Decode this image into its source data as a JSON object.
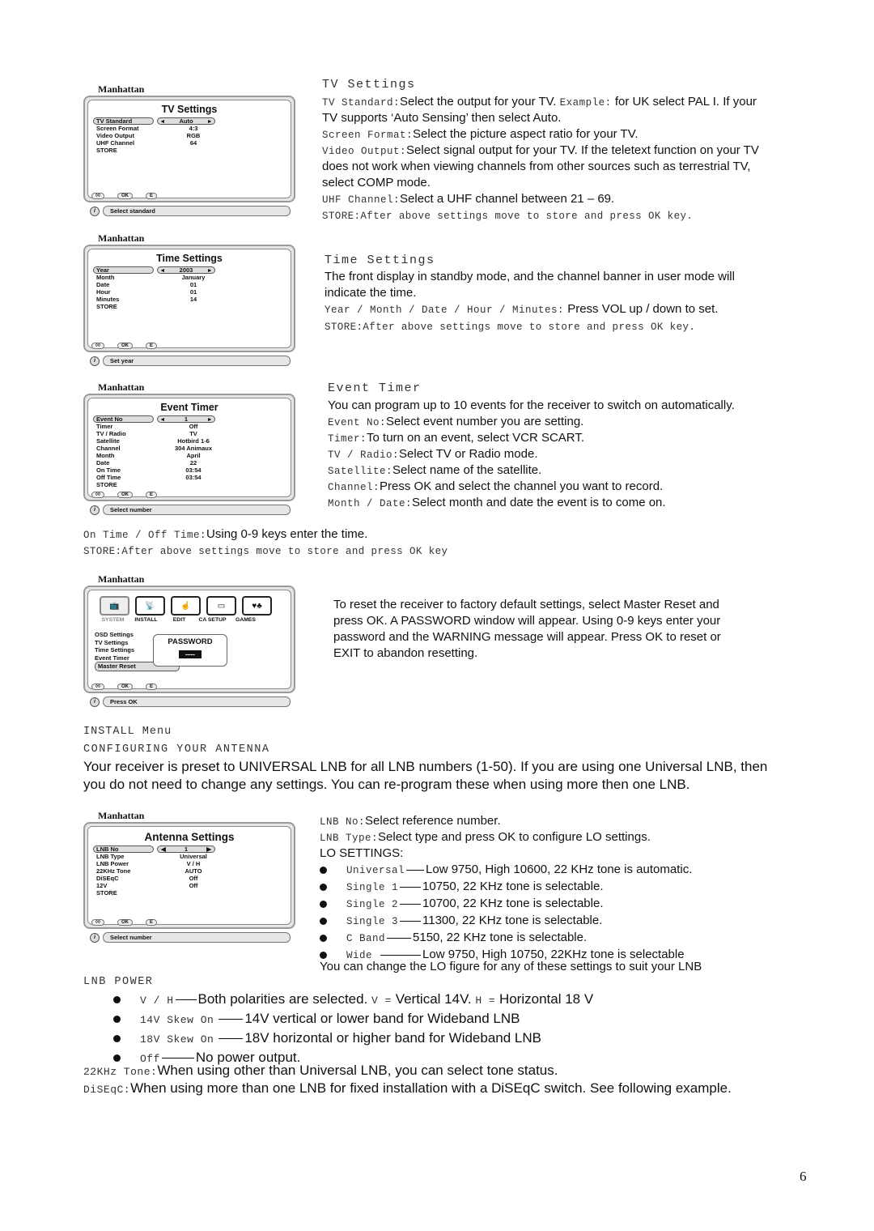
{
  "page_number": "6",
  "tv_settings": {
    "osd": {
      "brand": "Manhattan",
      "title": "TV Settings",
      "rows": [
        {
          "label": "TV Standard",
          "value": "Auto",
          "selected": true
        },
        {
          "label": "Screen Format",
          "value": "4:3"
        },
        {
          "label": "Video Output",
          "value": "RGB"
        },
        {
          "label": "UHF Channel",
          "value": "64"
        },
        {
          "label": "STORE",
          "value": ""
        }
      ],
      "footer_keys": [
        "◊◊",
        "OK",
        "E"
      ],
      "hint": "Select standard",
      "info_icon": "i"
    },
    "heading": "TV Settings",
    "lines": [
      {
        "term": "TV Standard:",
        "text": "Select the output for your TV.",
        "term2": "Example:",
        "text2": "for UK select PAL I. If your"
      },
      {
        "text": "TV supports ‘Auto Sensing’ then select Auto."
      },
      {
        "term": "Screen Format:",
        "text": "Select the picture aspect ratio for your TV."
      },
      {
        "term": "Video Output:",
        "text": "Select signal output for your TV. If the teletext function on your TV"
      },
      {
        "text": "does not work when viewing channels from other sources such as terrestrial TV,"
      },
      {
        "text": "select COMP mode."
      },
      {
        "term": "UHF Channel:",
        "text": "Select a UHF channel between  21 – 69."
      }
    ],
    "store": "STORE:After above settings move to store and press OK key."
  },
  "time_settings": {
    "osd": {
      "brand": "Manhattan",
      "title": "Time Settings",
      "rows": [
        {
          "label": "Year",
          "value": "2003",
          "selected": true
        },
        {
          "label": "Month",
          "value": "January"
        },
        {
          "label": "Date",
          "value": "01"
        },
        {
          "label": "Hour",
          "value": "01"
        },
        {
          "label": "Minutes",
          "value": "14"
        },
        {
          "label": "STORE",
          "value": ""
        }
      ],
      "footer_keys": [
        "◊◊",
        "OK",
        "E"
      ],
      "hint": "Set year",
      "info_icon": "i"
    },
    "heading": "Time Settings",
    "para1": "The front display in standby mode, and the channel banner in user mode will",
    "para2": "indicate the time.",
    "term": "Year / Month / Date / Hour / Minutes:",
    "text": "Press VOL up / down to set.",
    "store": "STORE:After above settings move to store and press OK key."
  },
  "event_timer": {
    "osd": {
      "brand": "Manhattan",
      "title": "Event Timer",
      "rows": [
        {
          "label": "Event No",
          "value": "1",
          "selected": true
        },
        {
          "label": "Timer",
          "value": "Off"
        },
        {
          "label": "TV / Radio",
          "value": "TV"
        },
        {
          "label": "Satellite",
          "value": "Hotbird 1-6"
        },
        {
          "label": "Channel",
          "value": "304 Animaux"
        },
        {
          "label": "Month",
          "value": "April"
        },
        {
          "label": "Date",
          "value": "22"
        },
        {
          "label": "On Time",
          "value": "03:54"
        },
        {
          "label": "Off Time",
          "value": "03:54"
        },
        {
          "label": "STORE",
          "value": ""
        }
      ],
      "footer_keys": [
        "◊◊",
        "OK",
        "E"
      ],
      "hint": "Select number",
      "info_icon": "i"
    },
    "heading": "Event Timer",
    "intro": "You can program up to 10 events for the receiver to switch on automatically.",
    "lines": [
      {
        "term": "Event No:",
        "text": "Select event number you are setting."
      },
      {
        "term": "Timer:",
        "text": "To turn on an event, select VCR SCART."
      },
      {
        "term": "TV / Radio:",
        "text": "Select TV or Radio mode."
      },
      {
        "term": "Satellite:",
        "text": "Select name of the satellite."
      },
      {
        "term": "Channel:",
        "text": "Press OK and select the channel you want to record."
      },
      {
        "term": "Month / Date:",
        "text": "Select month and date the event is to come on."
      }
    ],
    "on_off_term": "On Time / Off Time:",
    "on_off_text": "Using 0-9 keys enter the time.",
    "store": "STORE:After above settings move to store and press OK key"
  },
  "master_reset": {
    "osd": {
      "brand": "Manhattan",
      "menu_tabs": [
        {
          "label": "SYSTEM",
          "icon": "tv-icon",
          "glyph": "📺",
          "active": true
        },
        {
          "label": "INSTALL",
          "icon": "satellite-dish-icon",
          "glyph": "📡"
        },
        {
          "label": "EDIT",
          "icon": "hand-keypad-icon",
          "glyph": "☝"
        },
        {
          "label": "CA SETUP",
          "icon": "card-icon",
          "glyph": "▭"
        },
        {
          "label": "GAMES",
          "icon": "card-suits-icon",
          "glyph": "♥♣"
        }
      ],
      "menu_items": [
        "OSD Settings",
        "TV Settings",
        "Time Settings",
        "Event Timer",
        "Master Reset"
      ],
      "password_title": "PASSWORD",
      "password_value": "----",
      "footer_keys": [
        "◊◊",
        "OK",
        "E"
      ],
      "hint": "Press OK",
      "info_icon": "i"
    },
    "para": [
      "To reset the receiver to factory default settings, select Master Reset and",
      "press OK. A  PASSWORD window will appear. Using 0-9 keys enter your",
      "password and the WARNING message will appear. Press OK to reset or",
      "EXIT to abandon resetting."
    ]
  },
  "install": {
    "heading1": "INSTALL Menu",
    "heading2": "CONFIGURING YOUR ANTENNA",
    "intro1": "Your receiver is preset to UNIVERSAL LNB for all LNB numbers (1-50). If you are using one Universal LNB, then",
    "intro2": "you do not need to change any settings. You can re-program these when using more then one LNB.",
    "osd": {
      "brand": "Manhattan",
      "title": "Antenna Settings",
      "rows": [
        {
          "label": "LNB No",
          "value": "1",
          "selected": true
        },
        {
          "label": "LNB Type",
          "value": "Universal"
        },
        {
          "label": "LNB Power",
          "value": "V / H"
        },
        {
          "label": "22KHz Tone",
          "value": "AUTO"
        },
        {
          "label": "DiSEqC",
          "value": "Off"
        },
        {
          "label": "12V",
          "value": "Off"
        },
        {
          "label": "STORE",
          "value": ""
        }
      ],
      "footer_keys": [
        "◊◊",
        "OK",
        "E"
      ],
      "hint": "Select number",
      "info_icon": "i"
    },
    "lnb_no_term": "LNB No:",
    "lnb_no_text": "Select reference number.",
    "lnb_type_term": "LNB Type:",
    "lnb_type_text": "Select type and press OK to configure LO settings.",
    "lo_title": "LO SETTINGS:",
    "lo_settings": [
      {
        "term": "Universal",
        "text": "Low 9750, High 10600, 22 KHz tone is automatic."
      },
      {
        "term": "Single 1",
        "text": "10750, 22 KHz tone is selectable."
      },
      {
        "term": "Single 2",
        "text": "10700, 22 KHz tone is selectable."
      },
      {
        "term": "Single 3",
        "text": "11300, 22 KHz tone is selectable."
      },
      {
        "term": "C Band",
        "text": "5150, 22 KHz tone is selectable."
      },
      {
        "term": "Wide",
        "text": "Low 9750, High 10750, 22KHz tone is selectable"
      }
    ],
    "lo_note": "You can change the LO figure for any of these settings to suit your LNB",
    "lnb_power_heading": "LNB POWER",
    "lnb_power": [
      {
        "term": "V / H",
        "text": "Both polarities are selected.",
        "v_term": "V =",
        "v_text": "Vertical 14V.",
        "h_term": "H =",
        "h_text": "Horizontal 18 V"
      },
      {
        "term": "14V Skew On",
        "text": "14V vertical or lower band for Wideband LNB"
      },
      {
        "term": "18V Skew On",
        "text": "18V horizontal or higher band for Wideband LNB"
      },
      {
        "term": "Off",
        "text": "No power output."
      }
    ],
    "tone_term": "22KHz Tone:",
    "tone_text": "When using other than Universal LNB, you can select tone status.",
    "diseqc_term": "DiSEqC:",
    "diseqc_text": "When using more than one LNB for fixed installation with a DiSEqC switch. See following example."
  }
}
